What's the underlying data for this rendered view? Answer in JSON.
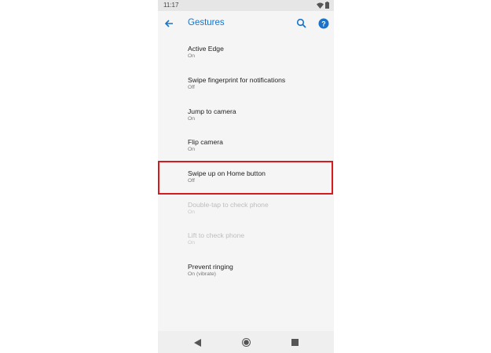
{
  "status_bar": {
    "time": "11:17",
    "icons": [
      "wifi-icon",
      "battery-icon"
    ]
  },
  "toolbar": {
    "title": "Gestures",
    "back_icon": "arrow-left-icon",
    "search_icon": "search-icon",
    "help_icon": "help-icon",
    "accent_color": "#1a73c8"
  },
  "settings": [
    {
      "title": "Active Edge",
      "summary": "On",
      "enabled": true
    },
    {
      "title": "Swipe fingerprint for notifications",
      "summary": "Off",
      "enabled": true
    },
    {
      "title": "Jump to camera",
      "summary": "On",
      "enabled": true
    },
    {
      "title": "Flip camera",
      "summary": "On",
      "enabled": true
    },
    {
      "title": "Swipe up on Home button",
      "summary": "Off",
      "enabled": true,
      "highlighted": true
    },
    {
      "title": "Double-tap to check phone",
      "summary": "On",
      "enabled": false
    },
    {
      "title": "Lift to check phone",
      "summary": "On",
      "enabled": false
    },
    {
      "title": "Prevent ringing",
      "summary": "On (vibrate)",
      "enabled": true
    }
  ],
  "highlight_color": "#d71920",
  "nav_bar": {
    "icons": [
      "back-triangle-icon",
      "home-circle-icon",
      "recents-square-icon"
    ]
  }
}
